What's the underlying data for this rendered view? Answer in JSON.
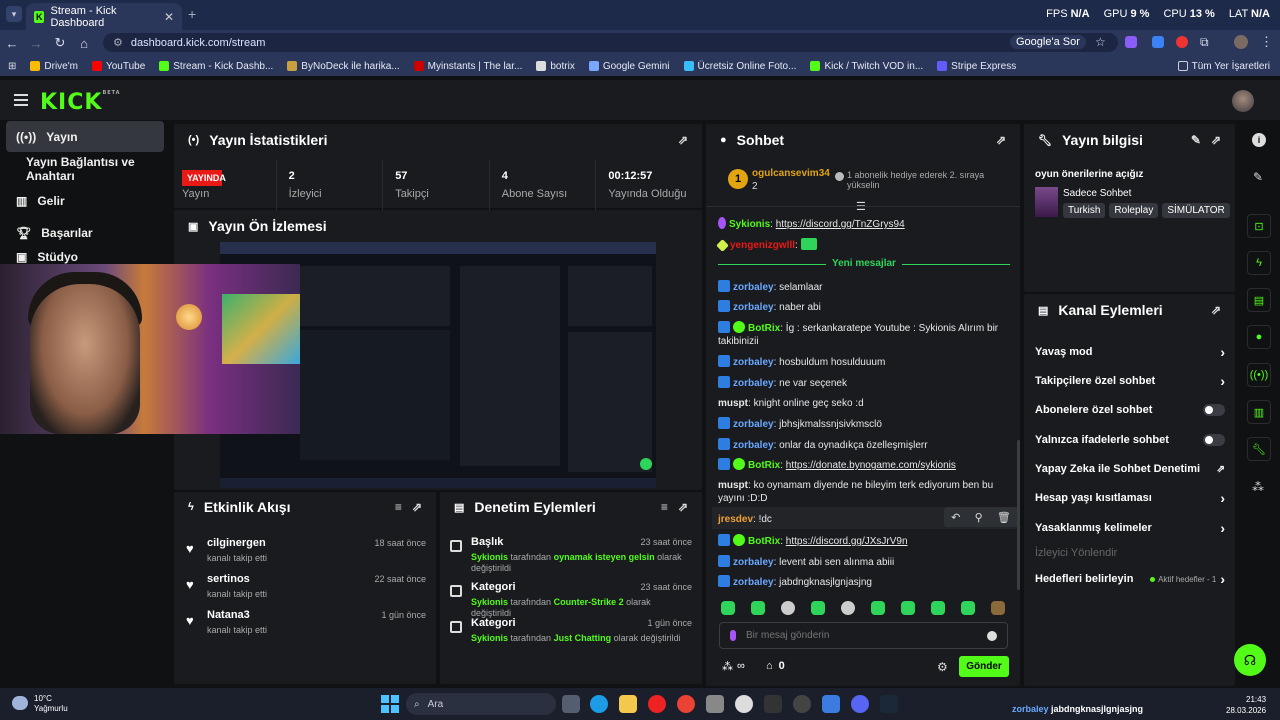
{
  "browser": {
    "tab_title": "Stream - Kick Dashboard",
    "url": "dashboard.kick.com/stream",
    "google_sor": "Google'a Sor",
    "perf": [
      {
        "label": "FPS",
        "value": "N/A"
      },
      {
        "label": "GPU",
        "value": "9 %"
      },
      {
        "label": "CPU",
        "value": "13 %"
      },
      {
        "label": "LAT",
        "value": "N/A"
      }
    ],
    "bookmarks": [
      "Drive'm",
      "YouTube",
      "Stream - Kick Dashb...",
      "ByNoDeck ile harika...",
      "Myinstants | The lar...",
      "botrix",
      "Google Gemini",
      "Ücretsiz Online Foto...",
      "Kick / Twitch VOD in...",
      "Stripe Express"
    ],
    "bookmarks_all": "Tüm Yer İşaretleri"
  },
  "logo": {
    "text": "KICK",
    "sup": "BETA"
  },
  "sidebar": {
    "items": [
      {
        "label": "Yayın",
        "icon": "broadcast-icon"
      },
      {
        "label": "Yayın Bağlantısı ve Anahtarı",
        "icon": ""
      },
      {
        "label": "Gelir",
        "icon": "chart-icon"
      },
      {
        "label": "Başarılar",
        "icon": "trophy-icon"
      },
      {
        "label": "Stüdyo",
        "icon": "studio-icon"
      }
    ]
  },
  "stats": {
    "title": "Yayın İstatistikleri",
    "live_badge": "YAYINDA",
    "stream_label": "Yayın",
    "cells": [
      {
        "value": "2",
        "label": "İzleyici"
      },
      {
        "value": "57",
        "label": "Takipçi"
      },
      {
        "value": "4",
        "label": "Abone Sayısı"
      },
      {
        "value": "00:12:57",
        "label": "Yayında Olduğu"
      }
    ]
  },
  "preview": {
    "title": "Yayın Ön İzlemesi"
  },
  "activity": {
    "title": "Etkinlik Akışı",
    "items": [
      {
        "name": "cilginergen",
        "sub": "kanalı takip etti",
        "time": "18 saat önce"
      },
      {
        "name": "sertinos",
        "sub": "kanalı takip etti",
        "time": "22 saat önce"
      },
      {
        "name": "Natana3",
        "sub": "kanalı takip etti",
        "time": "1 gün önce"
      }
    ]
  },
  "moderation": {
    "title": "Denetim Eylemleri",
    "items": [
      {
        "name": "Başlık",
        "who": "Sykionis",
        "mid": "tarafından",
        "val": "oynamak isteyen gelsin",
        "end": "olarak değiştirildi",
        "time": "23 saat önce"
      },
      {
        "name": "Kategori",
        "who": "Sykionis",
        "mid": "tarafından",
        "val": "Counter-Strike 2",
        "end": "olarak değiştirildi",
        "time": "23 saat önce"
      },
      {
        "name": "Kategori",
        "who": "Sykionis",
        "mid": "tarafından",
        "val": "Just Chatting",
        "end": "olarak değiştirildi",
        "time": "1 gün önce"
      }
    ]
  },
  "chat": {
    "title": "Sohbet",
    "pinned_user": "ogulcansevim34",
    "pinned_count": "2",
    "pinned_rank": "1",
    "pinned_note": "1 abonelik hediye ederek 2. sıraya yükselin",
    "new_messages": "Yeni mesajlar",
    "messages": [
      {
        "user": "Sykionis",
        "text": "https://discord.gg/TnZGrys94",
        "link": true,
        "color": "#53fc18"
      },
      {
        "user": "yengenizgwlll",
        "text": "",
        "color": "#e91916"
      },
      {
        "user": "zorbaley",
        "text": "selamlaar",
        "color": "#6aa8ff"
      },
      {
        "user": "zorbaley",
        "text": "naber abi",
        "color": "#6aa8ff"
      },
      {
        "user": "BotRix",
        "text": "İg : serkankaratepe Youtube : Sykionis Alırım bir takibinizii",
        "color": "#53fc18"
      },
      {
        "user": "zorbaley",
        "text": "hosbuldum hosulduuum",
        "color": "#6aa8ff"
      },
      {
        "user": "zorbaley",
        "text": "ne var seçenek",
        "color": "#6aa8ff"
      },
      {
        "user": "muspt",
        "text": "knight online geç seko :d",
        "color": "#e8e8e8"
      },
      {
        "user": "zorbaley",
        "text": "jbhsjkmalssnjsivkmsclö",
        "color": "#6aa8ff"
      },
      {
        "user": "zorbaley",
        "text": "onlar da oynadıkça özelleşmişlerr",
        "color": "#6aa8ff"
      },
      {
        "user": "BotRix",
        "text": "https://donate.bynogame.com/sykionis",
        "link": true,
        "color": "#53fc18"
      },
      {
        "user": "muspt",
        "text": "ko oynamam diyende ne bileyim terk ediyorum ben bu yayını :D:D",
        "color": "#e8e8e8"
      },
      {
        "user": "jresdev",
        "text": "!dc",
        "color": "#f0a030"
      },
      {
        "user": "BotRix",
        "text": "https://discord.gg/JXsJrV9n",
        "link": true,
        "color": "#53fc18"
      },
      {
        "user": "zorbaley",
        "text": "levent abi sen alınma abiii",
        "color": "#6aa8ff"
      },
      {
        "user": "zorbaley",
        "text": "jabdngknasjlgnjasjng",
        "color": "#6aa8ff"
      }
    ],
    "placeholder": "Bir mesaj gönderin",
    "infinity": "∞",
    "count": "0",
    "send": "Gönder"
  },
  "stream_info": {
    "title": "Yayın bilgisi",
    "stream_title": "oyun önerilerine açığız",
    "category": "Sadece Sohbet",
    "tags": [
      "Turkish",
      "Roleplay",
      "SİMÜLATOR"
    ]
  },
  "channel_actions": {
    "title": "Kanal Eylemleri",
    "items": [
      {
        "label": "Yavaş mod",
        "kind": "chevron"
      },
      {
        "label": "Takipçilere özel sohbet",
        "kind": "chevron"
      },
      {
        "label": "Abonelere özel sohbet",
        "kind": "toggle"
      },
      {
        "label": "Yalnızca ifadelerle sohbet",
        "kind": "toggle"
      },
      {
        "label": "Yapay Zeka ile Sohbet Denetimi",
        "kind": "external"
      },
      {
        "label": "Hesap yaşı kısıtlaması",
        "kind": "chevron"
      },
      {
        "label": "Yasaklanmış kelimeler",
        "kind": "chevron"
      },
      {
        "label": "İzleyici Yönlendir",
        "kind": "disabled"
      },
      {
        "label": "Hedefleri belirleyin",
        "kind": "goal"
      }
    ],
    "goal_status": "Aktif hedefler - 1"
  },
  "taskbar": {
    "weather_temp": "10°C",
    "weather_desc": "Yağmurlu",
    "search": "Ara",
    "notif_user": "zorbaley",
    "notif_text": "jabdngknasjlgnjasjng",
    "time": "21:43",
    "date": "28.03.2026"
  }
}
